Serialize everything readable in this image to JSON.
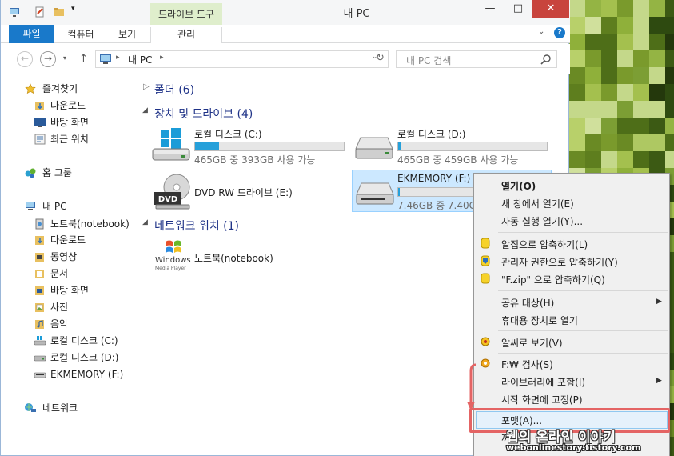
{
  "window": {
    "title": "내 PC",
    "contextual_tab_group": "드라이브 도구",
    "controls": {
      "minimize": "—",
      "maximize": "□",
      "close": "✕"
    }
  },
  "ribbon": {
    "file_tab": "파일",
    "tabs": [
      "컴퓨터",
      "보기",
      "관리"
    ],
    "accent": "#1979ca",
    "contextual_color": "#dfeecc"
  },
  "address": {
    "path_root": "내 PC",
    "search_placeholder": "내 PC 검색"
  },
  "sidebar": {
    "favorites": {
      "label": "즐겨찾기",
      "items": [
        "다운로드",
        "바탕 화면",
        "최근 위치"
      ]
    },
    "homegroup": "홈 그룹",
    "this_pc": {
      "label": "내 PC",
      "items": [
        "노트북(notebook)",
        "다운로드",
        "동영상",
        "문서",
        "바탕 화면",
        "사진",
        "음악",
        "로컬 디스크 (C:)",
        "로컬 디스크 (D:)",
        "EKMEMORY (F:)"
      ]
    },
    "network": "네트워크"
  },
  "content": {
    "folders_group": "폴더 (6)",
    "drives_group": "장치 및 드라이브 (4)",
    "drives": [
      {
        "name": "로컬 디스크 (C:)",
        "free": "465GB 중 393GB 사용 가능",
        "used_fraction": 0.16
      },
      {
        "name": "로컬 디스크 (D:)",
        "free": "465GB 중 459GB 사용 가능",
        "used_fraction": 0.02
      },
      {
        "name": "DVD RW 드라이브 (E:)",
        "icon_label": "DVD"
      },
      {
        "name": "EKMEMORY (F:)",
        "free": "7.46GB 중 7.40GB",
        "used_fraction": 0.01
      }
    ],
    "network_group": "네트워크 위치 (1)",
    "network_item": {
      "name": "노트북(notebook)",
      "logo_line1": "Windows",
      "logo_line2": "Media Player"
    }
  },
  "context_menu": {
    "items": [
      {
        "label": "열기(O)",
        "bold": true
      },
      {
        "label": "새 창에서 열기(E)"
      },
      {
        "label": "자동 실행 열기(Y)..."
      },
      {
        "label": "알집으로 압축하기(L)",
        "icon": "alzip-icon"
      },
      {
        "label": "관리자 권한으로 압축하기(Y)",
        "icon": "shield-alzip-icon"
      },
      {
        "label": "\"F.zip\" 으로 압축하기(Q)",
        "icon": "alzip-icon"
      },
      {
        "label": "공유 대상(H)",
        "submenu": true
      },
      {
        "label": "휴대용 장치로 열기"
      },
      {
        "label": "알씨로 보기(V)",
        "icon": "alsee-icon"
      },
      {
        "label": "F:₩ 검사(S)",
        "icon": "alyac-icon"
      },
      {
        "label": "라이브러리에 포함(I)",
        "submenu": true
      },
      {
        "label": "시작 화면에 고정(P)"
      },
      {
        "label": "포맷(A)...",
        "highlighted": true
      },
      {
        "label": "꺼내기"
      }
    ],
    "highlight_color": "#e46464"
  },
  "watermark": {
    "title": "웹의 온라인 이야기",
    "url": "webonlinestory.tistory.com"
  }
}
